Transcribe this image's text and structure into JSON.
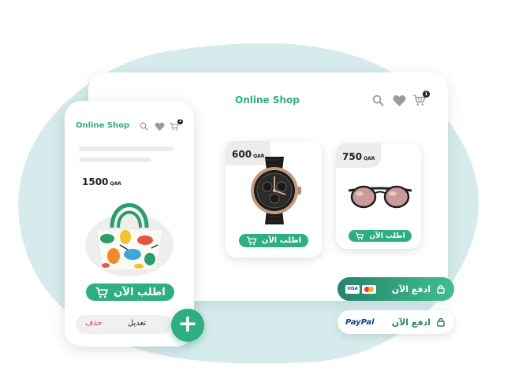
{
  "tablet": {
    "title": "Online Shop",
    "cart_count": "1",
    "products": [
      {
        "price": "600",
        "currency": "QAR",
        "order_label": "اطلب الآن",
        "item": "watch"
      },
      {
        "price": "750",
        "currency": "QAR",
        "order_label": "اطلب الآن",
        "item": "sunglasses"
      }
    ]
  },
  "phone": {
    "title": "Online Shop",
    "cart_count": "1",
    "product": {
      "price": "1500",
      "currency": "QAR",
      "order_label": "اطلب الآن",
      "item": "handbag"
    },
    "edit_label": "تعديل",
    "delete_label": "حذف"
  },
  "fab": {
    "label": "+"
  },
  "payments": [
    {
      "label": "ادفع الآن",
      "methods": [
        "VISA",
        "Mastercard"
      ]
    },
    {
      "label": "ادفع الآن",
      "methods": [
        "PayPal"
      ]
    }
  ],
  "colors": {
    "accent": "#2fae84",
    "blob": "#d6ecec",
    "delete": "#e0453a",
    "dark_teal": "#26836c"
  },
  "icons": [
    "search-icon",
    "heart-icon",
    "cart-icon",
    "lock-icon",
    "plus-icon"
  ]
}
